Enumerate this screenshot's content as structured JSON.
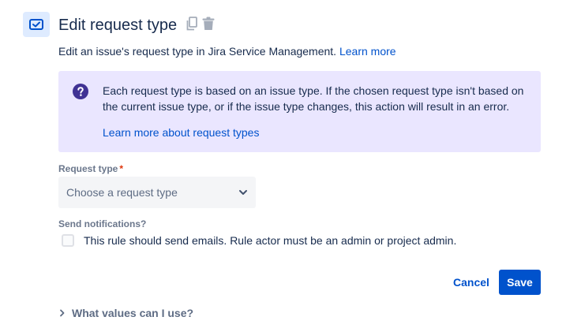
{
  "header": {
    "title": "Edit request type",
    "icon": "request-type-icon",
    "actions": [
      {
        "icon": "copy-icon"
      },
      {
        "icon": "trash-icon"
      }
    ]
  },
  "description": {
    "text": "Edit an issue's request type in Jira Service Management.",
    "link": "Learn more"
  },
  "info_panel": {
    "icon": "question-icon",
    "text": "Each request type is based on an issue type. If the chosen request type isn't based on the current issue type, or if the issue type changes, this action will result in an error.",
    "link": "Learn more about request types",
    "background": "#EAE6FF",
    "icon_color": "#403294"
  },
  "form": {
    "request_type": {
      "label": "Request type",
      "required_marker": "*",
      "placeholder": "Choose a request type"
    },
    "notifications": {
      "label": "Send notifications?",
      "checkbox_label": "This rule should send emails. Rule actor must be an admin or project admin.",
      "checked": false
    }
  },
  "footer": {
    "cancel_label": "Cancel",
    "save_label": "Save"
  },
  "help": {
    "label": "What values can I use?"
  },
  "colors": {
    "accent": "#0052CC",
    "text": "#172B4D",
    "subtle": "#6B778C"
  }
}
